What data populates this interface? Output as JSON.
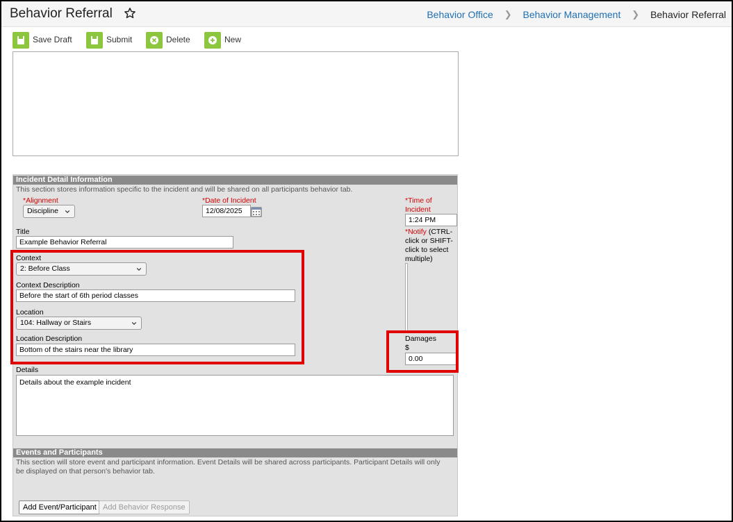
{
  "header": {
    "title": "Behavior Referral",
    "breadcrumb": [
      "Behavior Office",
      "Behavior Management",
      "Behavior Referral"
    ]
  },
  "toolbar": {
    "save_draft": "Save Draft",
    "submit": "Submit",
    "delete": "Delete",
    "new": "New"
  },
  "incident": {
    "section_title": "Incident Detail Information",
    "section_desc": "This section stores information specific to the incident and will be shared on all participants behavior tab.",
    "alignment_label": "*Alignment",
    "alignment_value": "Discipline",
    "date_label": "*Date of Incident",
    "date_value": "12/08/2025",
    "time_label_1": "*Time of",
    "time_label_2": "Incident",
    "time_value": "1:24 PM",
    "notify_req": "*Notify",
    "notify_rest_1": " (CTRL-",
    "notify_line_2": "click or SHIFT-",
    "notify_line_3": "click to select",
    "notify_line_4": "multiple)",
    "title_label": "Title",
    "title_value": "Example Behavior Referral",
    "context_label": "Context",
    "context_value": "2: Before Class",
    "context_desc_label": "Context Description",
    "context_desc_value": "Before the start of 6th period classes",
    "location_label": "Location",
    "location_value": "104: Hallway or Stairs",
    "location_desc_label": "Location Description",
    "location_desc_value": "Bottom of the stairs near the library",
    "damages_label": "Damages",
    "damages_currency": "$",
    "damages_value": "0.00",
    "details_label": "Details",
    "details_value": "Details about the example incident"
  },
  "events": {
    "section_title": "Events and Participants",
    "section_desc_1": "This section will store event and participant information. Event Details will be shared across participants. Participant Details will only",
    "section_desc_2": "be displayed on that person's behavior tab.",
    "add_event_button": "Add Event/Participant",
    "add_response_button": "Add Behavior Response"
  },
  "colors": {
    "accent_green": "#8cc63f",
    "highlight_red": "#e00000",
    "link_blue": "#1f6fb2",
    "required_red": "#d40000"
  },
  "icons": {
    "star": "star-icon",
    "save": "save-icon",
    "submit": "submit-icon",
    "delete": "delete-icon",
    "new": "plus-icon",
    "calendar": "calendar-icon",
    "chevron": "chevron-down-icon"
  }
}
